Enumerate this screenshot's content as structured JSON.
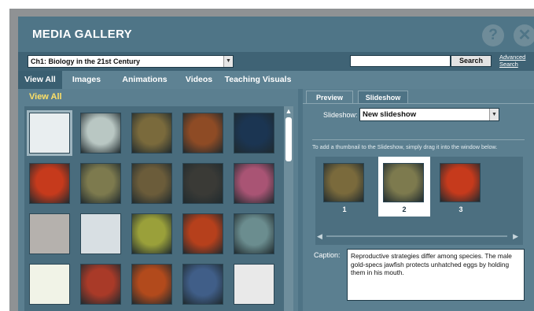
{
  "app": {
    "title": "MEDIA GALLERY",
    "help_glyph": "?",
    "close_glyph": "✕",
    "colors": {
      "accent": "#ffe066",
      "panel": "#5b7f90",
      "header": "#4f7587"
    }
  },
  "controls": {
    "chapter_select": "Ch1: Biology in the 21st Century",
    "search_value": "",
    "search_button": "Search",
    "advanced_line1": "Advanced",
    "advanced_line2": "Search"
  },
  "nav_tabs": [
    "View All",
    "Images",
    "Animations",
    "Videos",
    "Teaching Visuals"
  ],
  "gallery": {
    "heading": "View All",
    "thumbnails": [
      {
        "kind": "presentation-slide",
        "color": "#e9eef0"
      },
      {
        "kind": "flasks",
        "color": "#b9c7c3"
      },
      {
        "kind": "jawfish",
        "color": "#7a6a3c"
      },
      {
        "kind": "pine-bark-beetle",
        "color": "#8e4b25"
      },
      {
        "kind": "earth-globe",
        "color": "#1b3552"
      },
      {
        "kind": "red-plant",
        "color": "#c63a1c"
      },
      {
        "kind": "cell-specimen",
        "color": "#7d7a4e"
      },
      {
        "kind": "moth",
        "color": "#6b5c3a"
      },
      {
        "kind": "spider-legs",
        "color": "#3a3a36"
      },
      {
        "kind": "pink-insect",
        "color": "#a95474"
      },
      {
        "kind": "gray-disc",
        "color": "#b5b1ad"
      },
      {
        "kind": "polar-bear",
        "color": "#d8dfe3"
      },
      {
        "kind": "orchid",
        "color": "#9aa03a"
      },
      {
        "kind": "red-leaf",
        "color": "#b6401c"
      },
      {
        "kind": "scientist-hands",
        "color": "#6b8d8f"
      },
      {
        "kind": "variables-diagram",
        "color": "#f1f3e7"
      },
      {
        "kind": "red-tissue",
        "color": "#a93a28"
      },
      {
        "kind": "red-flowers",
        "color": "#b24a1c"
      },
      {
        "kind": "lab-researcher",
        "color": "#405e88"
      },
      {
        "kind": "microscope",
        "color": "#e9e9e9"
      }
    ]
  },
  "panel": {
    "tabs": [
      "Preview",
      "Slideshow"
    ],
    "slideshow_label": "Slideshow:",
    "slideshow_select": "New slideshow",
    "instruction": "To add a thumbnail to the Slideshow, simply drag it into the window below.",
    "slides": [
      {
        "number": "1",
        "kind": "jawfish",
        "color": "#7a6a3c"
      },
      {
        "number": "2",
        "kind": "cell-specimen",
        "color": "#7d7a4e"
      },
      {
        "number": "3",
        "kind": "red-plant",
        "color": "#c63a1c"
      }
    ],
    "scroll_left_glyph": "◀",
    "scroll_right_glyph": "▶",
    "caption_label": "Caption:",
    "caption_text": "Reproductive strategies differ among species. The male gold-specs jawfish protects unhatched eggs by holding them in his mouth."
  }
}
